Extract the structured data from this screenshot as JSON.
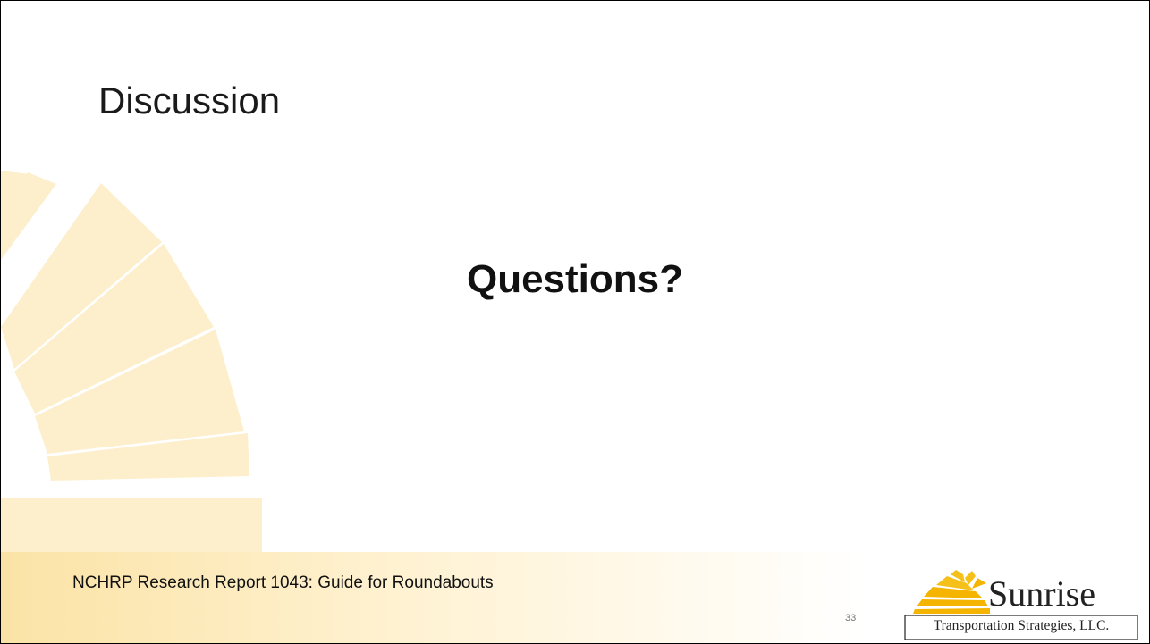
{
  "slide": {
    "title": "Discussion",
    "body": "Questions?",
    "footer_text": "NCHRP Research Report 1043: Guide for Roundabouts",
    "page_number": "33"
  },
  "logo": {
    "name": "Sunrise",
    "tagline": "Transportation Strategies, LLC."
  },
  "colors": {
    "sunburst_pale": "#fdefcc",
    "footer_band": "#fbe3a6",
    "logo_gold": "#f4b400"
  }
}
